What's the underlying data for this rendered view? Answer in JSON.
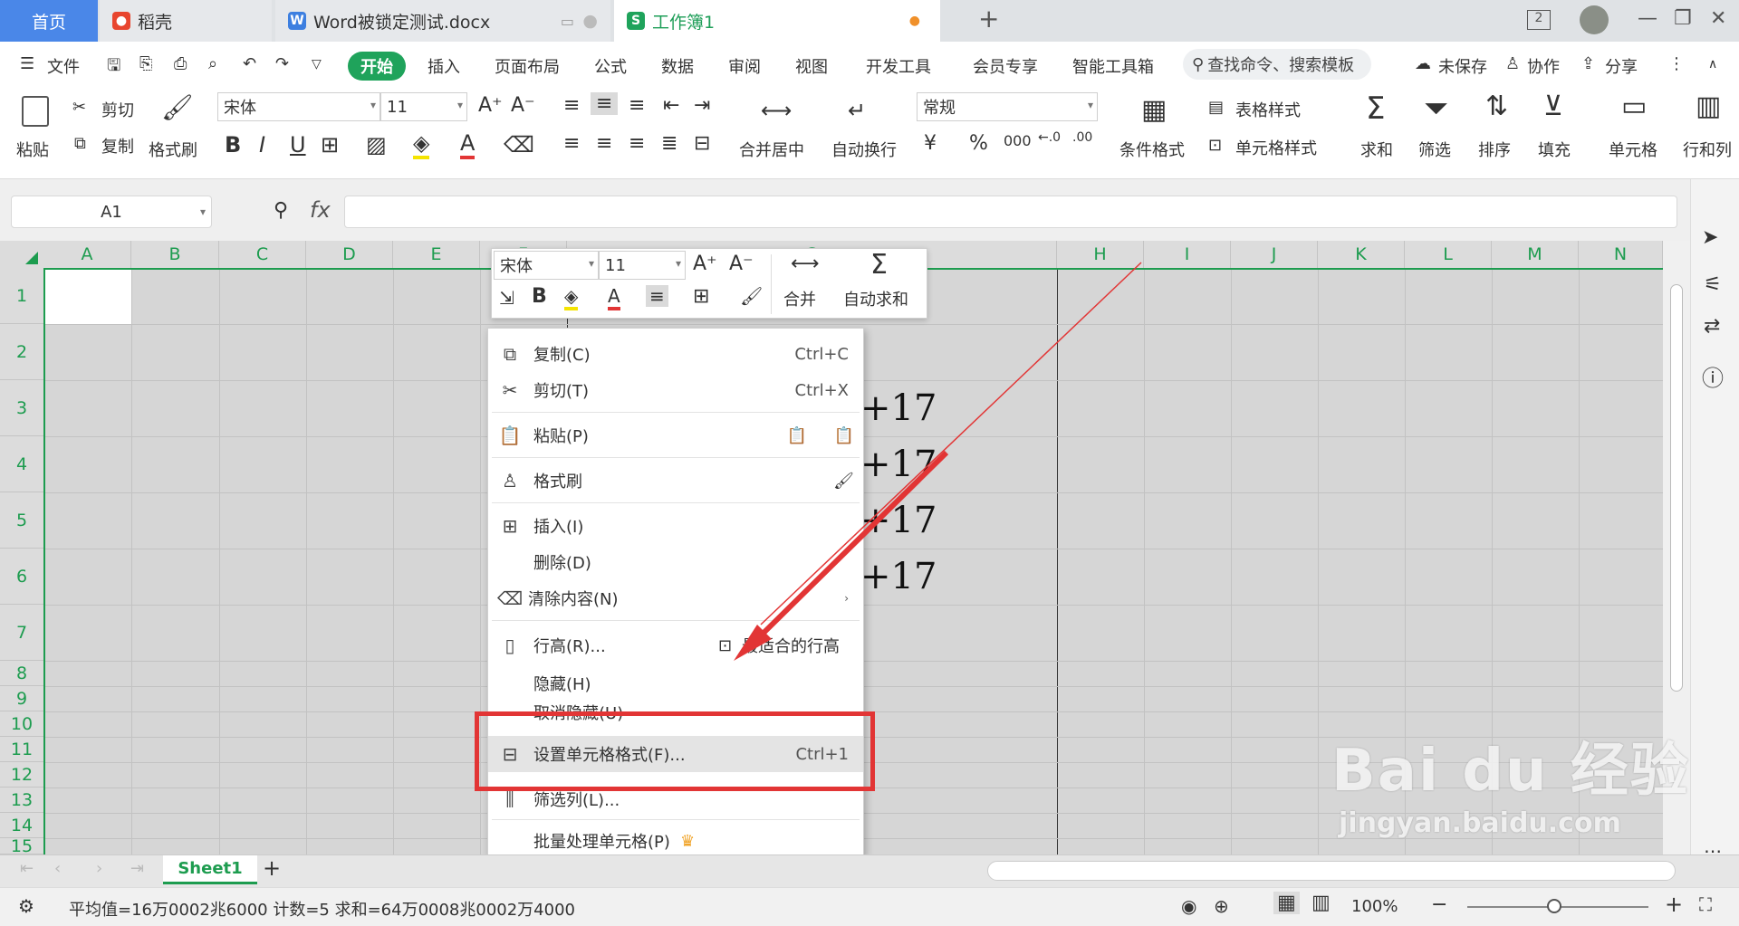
{
  "tabs": {
    "home": "首页",
    "daoke": "稻壳",
    "word": "Word被锁定测试.docx",
    "sheet": "工作簿1",
    "badge": "2"
  },
  "menu": {
    "file": "文件",
    "start": "开始",
    "insert": "插入",
    "layout": "页面布局",
    "formula": "公式",
    "data": "数据",
    "review": "审阅",
    "view": "视图",
    "dev": "开发工具",
    "vip": "会员专享",
    "smart": "智能工具箱",
    "search": "查找命令、搜索模板",
    "unsaved": "未保存",
    "collab": "协作",
    "share": "分享"
  },
  "ribbon": {
    "paste": "粘贴",
    "cut": "剪切",
    "copy": "复制",
    "format_painter": "格式刷",
    "font": "宋体",
    "size": "11",
    "merge": "合并居中",
    "wrap": "自动换行",
    "numfmt": "常规",
    "cond": "条件格式",
    "table_style": "表格样式",
    "cell_style": "单元格样式",
    "sum": "求和",
    "filter": "筛选",
    "sort": "排序",
    "fill": "填充",
    "cell": "单元格",
    "rowcol": "行和列",
    "bold": "B",
    "italic": "I",
    "underline": "U",
    "currency": "¥",
    "percent": "%",
    "thousands": "000"
  },
  "formula": {
    "namebox": "A1",
    "fx": "fx"
  },
  "columns": [
    "A",
    "B",
    "C",
    "D",
    "E",
    "F",
    "G",
    "H",
    "I",
    "J",
    "K",
    "L",
    "M",
    "N"
  ],
  "rows": [
    "1",
    "2",
    "3",
    "4",
    "5",
    "6",
    "7",
    "8",
    "9",
    "10",
    "11",
    "12",
    "13",
    "14",
    "15"
  ],
  "cells": {
    "r3": "+17",
    "r4": "+17",
    "r5": "+17",
    "r6": "+17"
  },
  "minitoolbar": {
    "font": "宋体",
    "size": "11",
    "merge": "合并",
    "autosum": "自动求和"
  },
  "context_menu": {
    "copy": "复制(C)",
    "copy_sc": "Ctrl+C",
    "cut": "剪切(T)",
    "cut_sc": "Ctrl+X",
    "paste": "粘贴(P)",
    "painter": "格式刷",
    "insert": "插入(I)",
    "delete": "删除(D)",
    "clear": "清除内容(N)",
    "rowheight": "行高(R)...",
    "bestfit": "最适合的行高",
    "hide": "隐藏(H)",
    "unhide": "取消隐藏(U)",
    "format": "设置单元格格式(F)...",
    "format_sc": "Ctrl+1",
    "filter": "筛选列(L)...",
    "batch": "批量处理单元格(P)"
  },
  "sheet_tab": "Sheet1",
  "status": {
    "text": "平均值=16万0002兆6000  计数=5  求和=64万0008兆0002万4000",
    "zoom": "100%"
  },
  "watermark": {
    "brand": "Bai du 经验",
    "url": "jingyan.baidu.com"
  },
  "colors": {
    "accent": "#1fa35b",
    "highlight": "#e23535"
  }
}
